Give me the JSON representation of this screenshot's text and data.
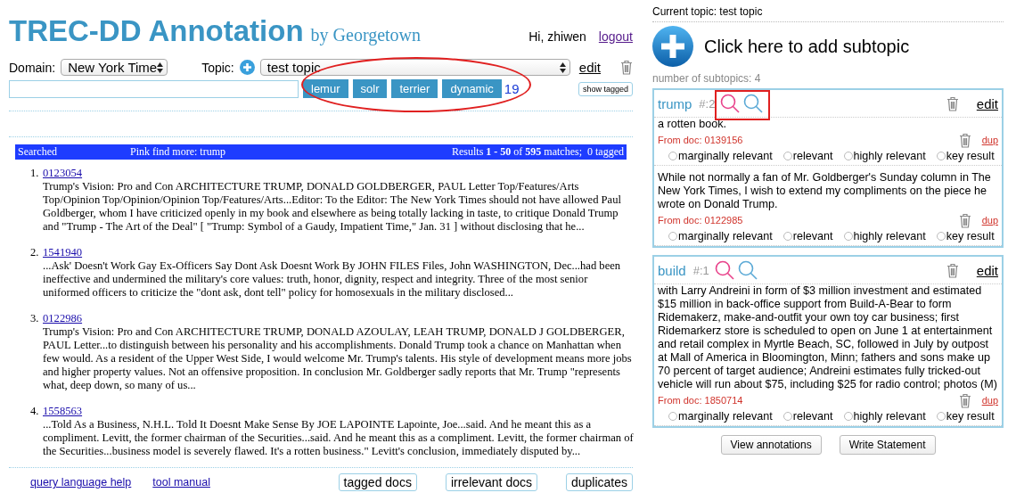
{
  "header": {
    "title": "TREC-DD Annotation",
    "subtitle": "by Georgetown",
    "greeting": "Hi, zhiwen",
    "logout": "logout"
  },
  "controls": {
    "domain_label": "Domain:",
    "domain_value": "New York Time",
    "topic_label": "Topic:",
    "topic_value": "test topic",
    "edit": "edit",
    "engines": [
      {
        "label": "lemur"
      },
      {
        "label": "solr"
      },
      {
        "label": "terrier"
      },
      {
        "label": "dynamic"
      }
    ],
    "count": "19",
    "show_tagged": "show tagged"
  },
  "results_bar": {
    "left": "Searched",
    "middle": "Pink find more: trump",
    "right": "Results **1 - 50** of **595** matches;  0 tagged"
  },
  "results": [
    {
      "number": "1.",
      "doc_id": "0123054",
      "snippet": "Trump's Vision: Pro and Con ARCHITECTURE TRUMP, DONALD GOLDBERGER, PAUL Letter Top/Features/Arts Top/Opinion Top/Opinion/Opinion Top/Features/Arts...Editor: To the Editor: The New York Times should not have allowed Paul Goldberger, whom I have criticized openly in my book and elsewhere as being totally lacking in taste, to critique Donald Trump and \"Trump - The Art of the Deal\" [ \"Trump: Symbol of a Gaudy, Impatient Time,\" Jan. 31 ] without disclosing that he..."
    },
    {
      "number": "2.",
      "doc_id": "1541940",
      "snippet": "...Ask' Doesn't Work Gay Ex-Officers Say Dont Ask Doesnt Work By JOHN FILES Files, John WASHINGTON, Dec...had been ineffective and undermined the military's core values: truth, honor, dignity, respect and integrity. Three of the most senior uniformed officers to criticize the \"dont ask, dont tell\" policy for homosexuals in the military disclosed..."
    },
    {
      "number": "3.",
      "doc_id": "0122986",
      "snippet": "Trump's Vision: Pro and Con ARCHITECTURE TRUMP, DONALD AZOULAY, LEAH TRUMP, DONALD J GOLDBERGER, PAUL Letter...to distinguish between his personality and his accomplishments. Donald Trump took a chance on Manhattan when few would. As a resident of the Upper West Side, I would welcome Mr. Trump's talents. His style of development means more jobs and higher property values. Not an offensive proposition. In conclusion Mr. Goldberger sadly reports that Mr. Trump \"represents what, deep down, so many of us..."
    },
    {
      "number": "4.",
      "doc_id": "1558563",
      "snippet": "...Told As a Business, N.H.L. Told It Doesnt Make Sense By JOE LAPOINTE Lapointe, Joe...said. And he meant this as a compliment. Levitt, the former chairman of the Securities...said. And he meant this as a compliment. Levitt, the former chairman of the Securities...business model is severely flawed. It's a rotten business.\" Levitt's conclusion, immediately disputed by..."
    }
  ],
  "footer": {
    "links": [
      "query language help",
      "tool manual"
    ],
    "buttons": [
      "tagged docs",
      "irrelevant docs",
      "duplicates"
    ]
  },
  "sidebar": {
    "current_topic": "Current topic: test topic",
    "add_subtopic": "Click here to add subtopic",
    "count": "number of subtopics: 4",
    "subtopics": [
      {
        "name": "trump",
        "number": "#:2",
        "edit": "edit",
        "passages": [
          {
            "text": "a rotten book.",
            "source": "From doc: 0139156",
            "dup": "dup",
            "ratings": [
              {
                "label": "marginally relevant",
                "selected": false
              },
              {
                "label": "relevant",
                "selected": false
              },
              {
                "label": "highly relevant",
                "selected": false
              },
              {
                "label": "key result",
                "selected": false
              }
            ]
          },
          {
            "text": "While not normally a fan of Mr. Goldberger's Sunday column in The New York Times, I wish to extend my compliments on the piece he wrote on Donald Trump.",
            "source": "From doc: 0122985",
            "dup": "dup",
            "ratings": [
              {
                "label": "marginally relevant",
                "selected": false
              },
              {
                "label": "relevant",
                "selected": false
              },
              {
                "label": "highly relevant",
                "selected": false
              },
              {
                "label": "key result",
                "selected": false
              }
            ]
          }
        ]
      },
      {
        "name": "build",
        "number": "#:1",
        "edit": "edit",
        "passages": [
          {
            "text": "with Larry Andreini in form of $3 million investment and estimated $15 million in back-office support from Build-A-Bear to form Ridemakerz, make-and-outfit your own toy car business; first Ridemarkerz store is scheduled to open on June 1 at entertainment and retail complex in Myrtle Beach, SC, followed in July by outpost at Mall of America in Bloomington, Minn; fathers and sons make up 70 percent of target audience; Andreini estimates fully tricked-out vehicle will run about $75, including $25 for radio control; photos (M)",
            "source": "From doc: 1850714",
            "dup": "dup",
            "ratings": [
              {
                "label": "marginally relevant",
                "selected": false
              },
              {
                "label": "relevant",
                "selected": false
              },
              {
                "label": "highly relevant",
                "selected": false
              },
              {
                "label": "key result",
                "selected": false
              }
            ]
          }
        ]
      }
    ],
    "buttons": [
      "View annotations",
      "Write Statement"
    ]
  }
}
